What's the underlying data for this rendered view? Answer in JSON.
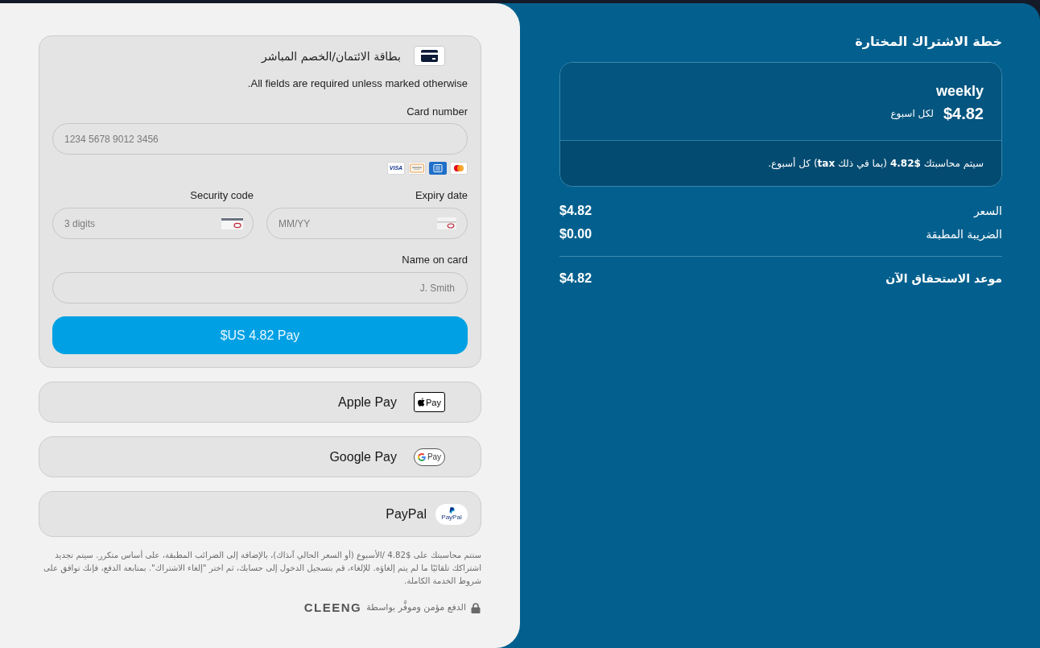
{
  "card_form": {
    "title": "بطاقة الائتمان/الخصم المباشر",
    "required_note": ".All fields are required unless marked otherwise",
    "card_number": {
      "label": "Card number",
      "placeholder": "1234 5678 9012 3456"
    },
    "card_brands": [
      {
        "kind": "visa",
        "label": "VISA"
      },
      {
        "kind": "discover"
      },
      {
        "kind": "amex"
      },
      {
        "kind": "mastercard"
      }
    ],
    "expiry_date": {
      "label": "Expiry date",
      "placeholder": "MM/YY"
    },
    "security_code": {
      "label": "Security code",
      "placeholder": "3 digits"
    },
    "name_on_card": {
      "label": "Name on card",
      "placeholder": "J. Smith"
    },
    "pay_button": "$US 4.82 Pay"
  },
  "wallets": [
    {
      "kind": "apple_pay",
      "label": "Apple Pay",
      "badge_text": "Pay"
    },
    {
      "kind": "google_pay",
      "label": "Google Pay",
      "badge_text": "Pay"
    },
    {
      "kind": "paypal",
      "label": "PayPal",
      "badge_text": "PayPal"
    }
  ],
  "legal_text": "ستتم محاسبتك على $4.82 /الأسبوع (أو السعر الحالي آنذاك)، بالإضافة إلى الضرائب المطبقة، على أساس متكرر. سيتم تجديد اشتراكك تلقائيًا ما لم يتم إلغاؤه. للإلغاء، قم بتسجيل الدخول إلى حسابك، ثم اختر \"إلغاء الاشتراك\". بمتابعة الدفع، فإنك توافق على شروط الخدمة الكاملة.",
  "secure_note": {
    "text": "الدفع مؤمن وموفَّر بواسطة",
    "brand": "CLEENG"
  },
  "summary": {
    "title": "خطة الاشتراك المختارة",
    "plan": {
      "name": "weekly",
      "price": "$4.82",
      "period": "لكل اسبوع",
      "note": "سيتم محاسبتك **$4.82** (بما في ذلك **tax**) كل أسبوع."
    },
    "lines": [
      {
        "label": "السعر",
        "amount": "$4.82"
      },
      {
        "label": "الضريبة المطبقة",
        "amount": "$0.00"
      }
    ],
    "total": {
      "label": "موعد الاستحقاق الآن",
      "amount": "$4.82"
    }
  }
}
